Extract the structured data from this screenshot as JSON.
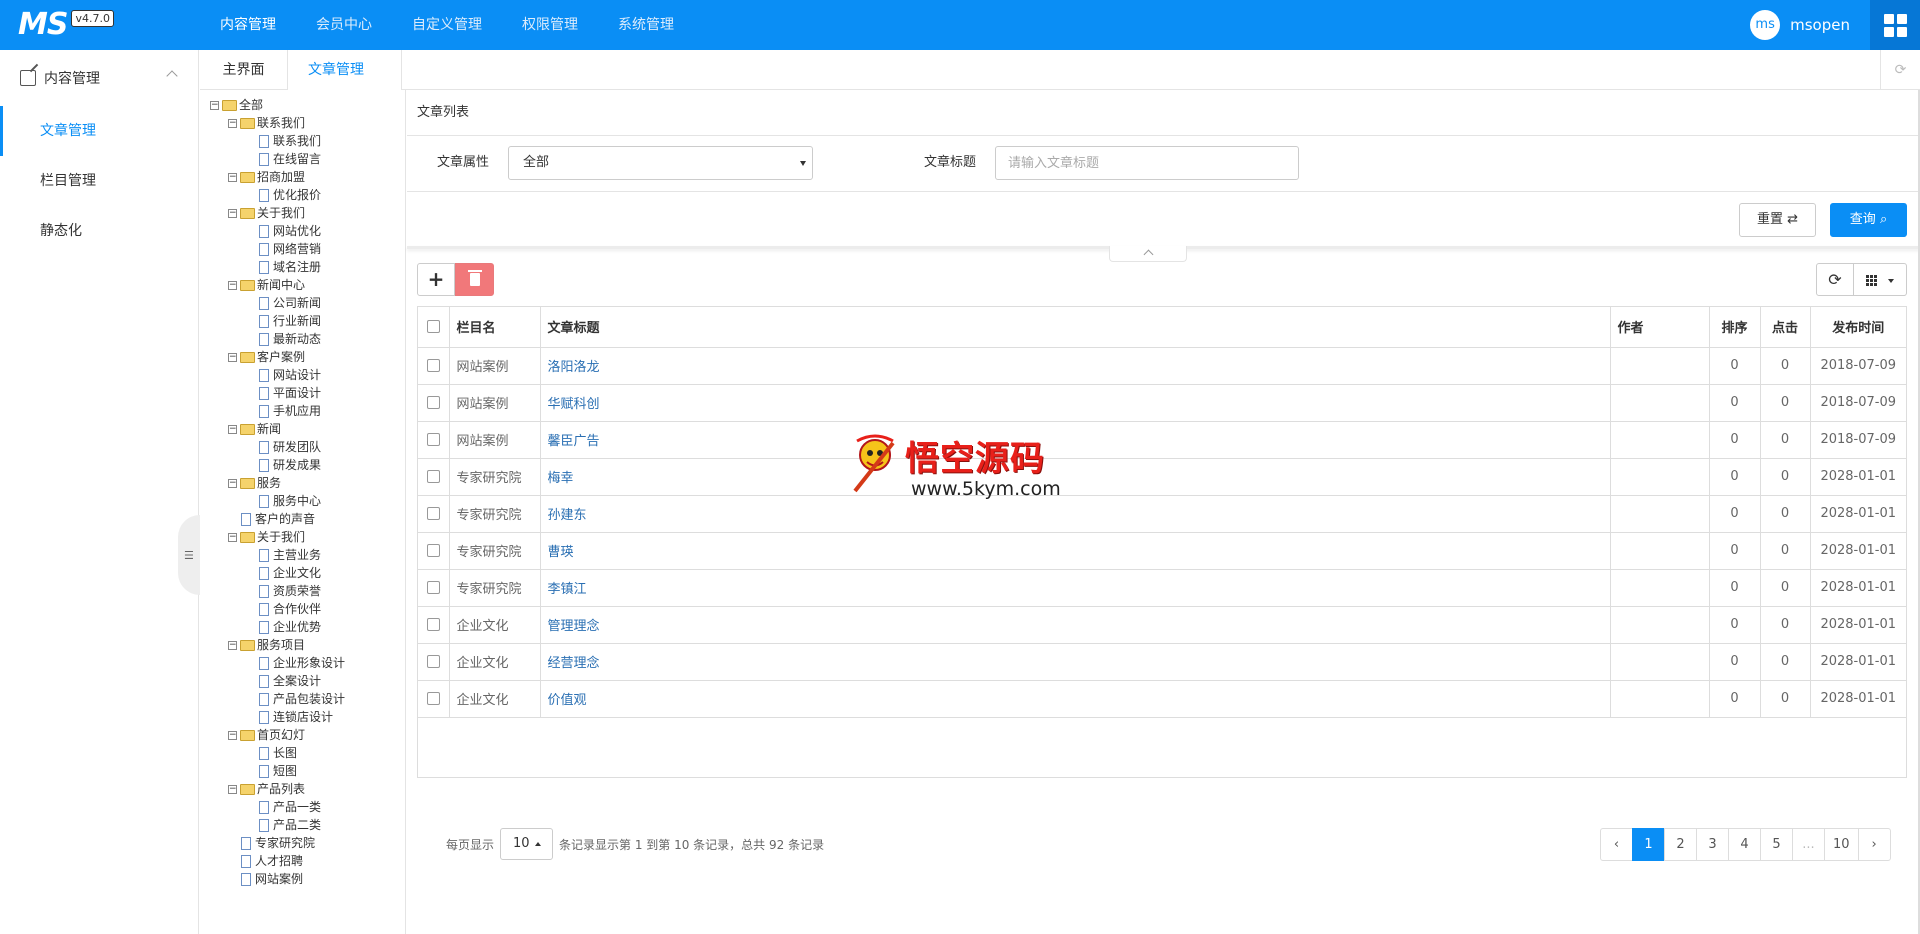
{
  "app": {
    "logo": "MS",
    "version": "v4.7.0"
  },
  "topnav": [
    {
      "label": "内容管理",
      "active": true
    },
    {
      "label": "会员中心",
      "active": false
    },
    {
      "label": "自定义管理",
      "active": false
    },
    {
      "label": "权限管理",
      "active": false
    },
    {
      "label": "系统管理",
      "active": false
    }
  ],
  "user": {
    "avatar": "ms",
    "name": "msopen"
  },
  "sidebar": {
    "section": "内容管理",
    "items": [
      {
        "label": "文章管理",
        "active": true
      },
      {
        "label": "栏目管理",
        "active": false
      },
      {
        "label": "静态化",
        "active": false
      }
    ]
  },
  "tabs": {
    "home": "主界面",
    "current": "文章管理",
    "close": "×"
  },
  "tree": [
    {
      "label": "全部",
      "type": "folder",
      "level": 0,
      "exp": "⊟"
    },
    {
      "label": "联系我们",
      "type": "folder",
      "level": 1,
      "exp": "⊟"
    },
    {
      "label": "联系我们",
      "type": "doc",
      "level": 2
    },
    {
      "label": "在线留言",
      "type": "doc",
      "level": 2
    },
    {
      "label": "招商加盟",
      "type": "folder",
      "level": 1,
      "exp": "⊟"
    },
    {
      "label": "优化报价",
      "type": "doc",
      "level": 2
    },
    {
      "label": "关于我们",
      "type": "folder",
      "level": 1,
      "exp": "⊟"
    },
    {
      "label": "网站优化",
      "type": "doc",
      "level": 2
    },
    {
      "label": "网络营销",
      "type": "doc",
      "level": 2
    },
    {
      "label": "域名注册",
      "type": "doc",
      "level": 2
    },
    {
      "label": "新闻中心",
      "type": "folder",
      "level": 1,
      "exp": "⊟"
    },
    {
      "label": "公司新闻",
      "type": "doc",
      "level": 2
    },
    {
      "label": "行业新闻",
      "type": "doc",
      "level": 2
    },
    {
      "label": "最新动态",
      "type": "doc",
      "level": 2
    },
    {
      "label": "客户案例",
      "type": "folder",
      "level": 1,
      "exp": "⊟"
    },
    {
      "label": "网站设计",
      "type": "doc",
      "level": 2
    },
    {
      "label": "平面设计",
      "type": "doc",
      "level": 2
    },
    {
      "label": "手机应用",
      "type": "doc",
      "level": 2
    },
    {
      "label": "新闻",
      "type": "folder",
      "level": 1,
      "exp": "⊟"
    },
    {
      "label": "研发团队",
      "type": "doc",
      "level": 2
    },
    {
      "label": "研发成果",
      "type": "doc",
      "level": 2
    },
    {
      "label": "服务",
      "type": "folder",
      "level": 1,
      "exp": "⊟"
    },
    {
      "label": "服务中心",
      "type": "doc",
      "level": 2
    },
    {
      "label": "客户的声音",
      "type": "doc",
      "level": 1
    },
    {
      "label": "关于我们",
      "type": "folder",
      "level": 1,
      "exp": "⊟"
    },
    {
      "label": "主营业务",
      "type": "doc",
      "level": 2
    },
    {
      "label": "企业文化",
      "type": "doc",
      "level": 2
    },
    {
      "label": "资质荣誉",
      "type": "doc",
      "level": 2
    },
    {
      "label": "合作伙伴",
      "type": "doc",
      "level": 2
    },
    {
      "label": "企业优势",
      "type": "doc",
      "level": 2
    },
    {
      "label": "服务项目",
      "type": "folder",
      "level": 1,
      "exp": "⊟"
    },
    {
      "label": "企业形象设计",
      "type": "doc",
      "level": 2
    },
    {
      "label": "全案设计",
      "type": "doc",
      "level": 2
    },
    {
      "label": "产品包装设计",
      "type": "doc",
      "level": 2
    },
    {
      "label": "连锁店设计",
      "type": "doc",
      "level": 2
    },
    {
      "label": "首页幻灯",
      "type": "folder",
      "level": 1,
      "exp": "⊟"
    },
    {
      "label": "长图",
      "type": "doc",
      "level": 2
    },
    {
      "label": "短图",
      "type": "doc",
      "level": 2
    },
    {
      "label": "产品列表",
      "type": "folder",
      "level": 1,
      "exp": "⊟"
    },
    {
      "label": "产品一类",
      "type": "doc",
      "level": 2
    },
    {
      "label": "产品二类",
      "type": "doc",
      "level": 2
    },
    {
      "label": "专家研究院",
      "type": "doc",
      "level": 1
    },
    {
      "label": "人才招聘",
      "type": "doc",
      "level": 1
    },
    {
      "label": "网站案例",
      "type": "doc",
      "level": 1
    }
  ],
  "main": {
    "list_title": "文章列表",
    "search": {
      "attr_label": "文章属性",
      "attr_value": "全部",
      "title_label": "文章标题",
      "title_placeholder": "请输入文章标题",
      "reset_label": "重置",
      "query_label": "查询"
    },
    "toolbar": {
      "add": "+",
      "refresh": "⟳"
    },
    "table": {
      "headers": {
        "column": "栏目名",
        "title": "文章标题",
        "author": "作者",
        "sort": "排序",
        "hits": "点击",
        "date": "发布时间"
      },
      "rows": [
        {
          "column": "网站案例",
          "title": "洛阳洛龙",
          "author": "",
          "sort": "0",
          "hits": "0",
          "date": "2018-07-09"
        },
        {
          "column": "网站案例",
          "title": "华赋科创",
          "author": "",
          "sort": "0",
          "hits": "0",
          "date": "2018-07-09"
        },
        {
          "column": "网站案例",
          "title": "馨臣广告",
          "author": "",
          "sort": "0",
          "hits": "0",
          "date": "2018-07-09"
        },
        {
          "column": "专家研究院",
          "title": "梅幸",
          "author": "",
          "sort": "0",
          "hits": "0",
          "date": "2028-01-01"
        },
        {
          "column": "专家研究院",
          "title": "孙建东",
          "author": "",
          "sort": "0",
          "hits": "0",
          "date": "2028-01-01"
        },
        {
          "column": "专家研究院",
          "title": "曹瑛",
          "author": "",
          "sort": "0",
          "hits": "0",
          "date": "2028-01-01"
        },
        {
          "column": "专家研究院",
          "title": "李镇江",
          "author": "",
          "sort": "0",
          "hits": "0",
          "date": "2028-01-01"
        },
        {
          "column": "企业文化",
          "title": "管理理念",
          "author": "",
          "sort": "0",
          "hits": "0",
          "date": "2028-01-01"
        },
        {
          "column": "企业文化",
          "title": "经营理念",
          "author": "",
          "sort": "0",
          "hits": "0",
          "date": "2028-01-01"
        },
        {
          "column": "企业文化",
          "title": "价值观",
          "author": "",
          "sort": "0",
          "hits": "0",
          "date": "2028-01-01"
        }
      ]
    },
    "pager": {
      "prefix": "每页显示",
      "page_size": "10",
      "summary": "条记录显示第 1 到第 10 条记录，总共 92 条记录",
      "pages": [
        "‹",
        "1",
        "2",
        "3",
        "4",
        "5",
        "...",
        "10",
        "›"
      ],
      "active_page": "1"
    }
  },
  "watermark": {
    "title": "悟空源码",
    "url": "www.5kym.com"
  },
  "colors": {
    "brand": "#0a8ef5",
    "danger": "#f1787a",
    "link": "#2a6fb3"
  }
}
